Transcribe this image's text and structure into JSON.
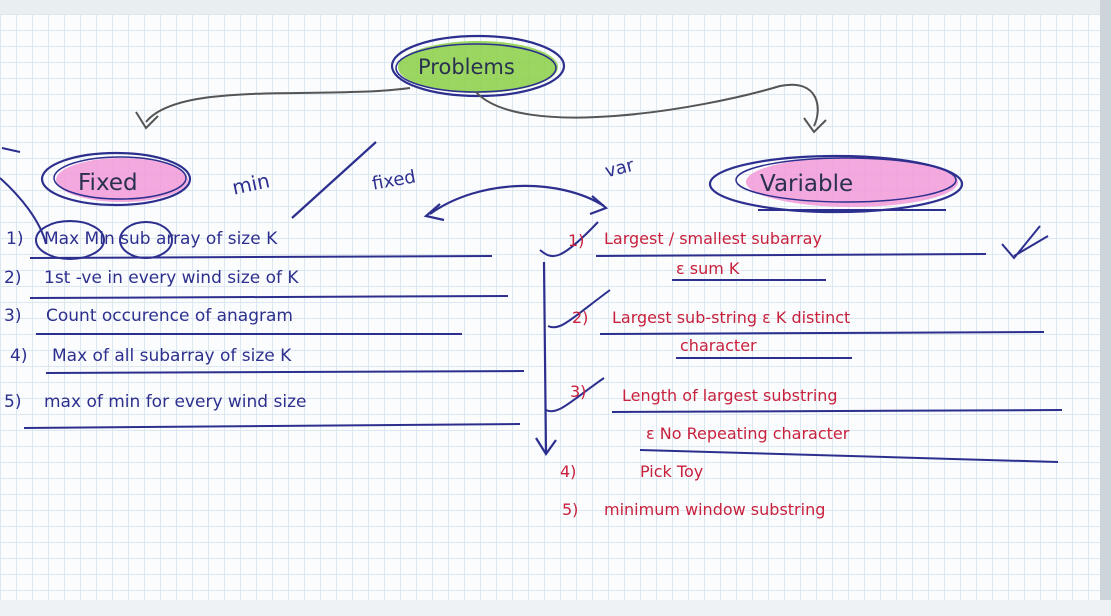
{
  "root": {
    "label": "Problems"
  },
  "fixed": {
    "label": "Fixed",
    "note_min": "min",
    "note_fixed": "fixed",
    "items": [
      {
        "num": "1)",
        "text": "Max Min sub array of size K"
      },
      {
        "num": "2)",
        "text": "1st -ve in every wind size of K"
      },
      {
        "num": "3)",
        "text": "Count occurence of anagram"
      },
      {
        "num": "4)",
        "text": "Max of all subarray of size K"
      },
      {
        "num": "5)",
        "text": "max of min for every wind size"
      }
    ]
  },
  "variable": {
    "label": "Variable",
    "note": "var",
    "items": [
      {
        "num": "1)",
        "line1": "Largest / smallest subarray",
        "line2": "ε sum K"
      },
      {
        "num": "2)",
        "line1": "Largest sub-string ε K distinct",
        "line2": "character"
      },
      {
        "num": "3)",
        "line1": "Length of largest substring",
        "line2": "ε No Repeating character"
      },
      {
        "num": "4)",
        "line1": "Pick Toy",
        "line2": ""
      },
      {
        "num": "5)",
        "line1": "minimum window substring",
        "line2": ""
      }
    ]
  },
  "colors": {
    "paper": "#fbfcfd",
    "grid": "#dde7ef",
    "pen_blue": "#2c2f8e",
    "pen_red": "#c8213d",
    "highlight_green": "#8fd14f",
    "highlight_pink": "#f29ad8",
    "arrow_ink": "#555555"
  }
}
